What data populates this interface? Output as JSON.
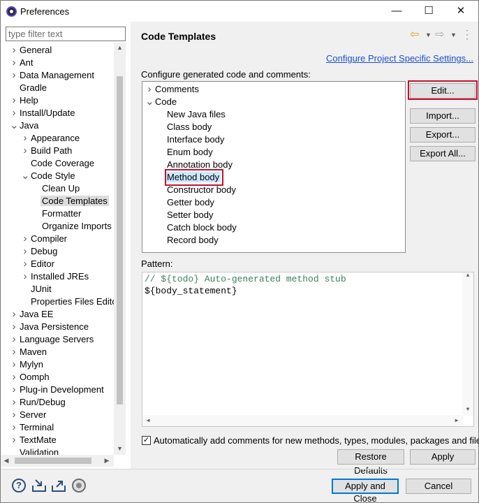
{
  "window": {
    "title": "Preferences",
    "minimize": "—",
    "maximize": "☐",
    "close": "✕"
  },
  "left": {
    "filter_placeholder": "type filter text",
    "items": [
      {
        "label": "General",
        "arrow": ">"
      },
      {
        "label": "Ant",
        "arrow": ">"
      },
      {
        "label": "Data Management",
        "arrow": ">"
      },
      {
        "label": "Gradle",
        "arrow": ""
      },
      {
        "label": "Help",
        "arrow": ">"
      },
      {
        "label": "Install/Update",
        "arrow": ">"
      },
      {
        "label": "Java",
        "arrow": "v"
      },
      {
        "label": "Appearance",
        "arrow": ">"
      },
      {
        "label": "Build Path",
        "arrow": ">"
      },
      {
        "label": "Code Coverage",
        "arrow": ""
      },
      {
        "label": "Code Style",
        "arrow": "v"
      },
      {
        "label": "Clean Up",
        "arrow": ""
      },
      {
        "label": "Code Templates",
        "arrow": ""
      },
      {
        "label": "Formatter",
        "arrow": ""
      },
      {
        "label": "Organize Imports",
        "arrow": ""
      },
      {
        "label": "Compiler",
        "arrow": ">"
      },
      {
        "label": "Debug",
        "arrow": ">"
      },
      {
        "label": "Editor",
        "arrow": ">"
      },
      {
        "label": "Installed JREs",
        "arrow": ">"
      },
      {
        "label": "JUnit",
        "arrow": ""
      },
      {
        "label": "Properties Files Editor",
        "arrow": ""
      },
      {
        "label": "Java EE",
        "arrow": ">"
      },
      {
        "label": "Java Persistence",
        "arrow": ">"
      },
      {
        "label": "Language Servers",
        "arrow": ">"
      },
      {
        "label": "Maven",
        "arrow": ">"
      },
      {
        "label": "Mylyn",
        "arrow": ">"
      },
      {
        "label": "Oomph",
        "arrow": ">"
      },
      {
        "label": "Plug-in Development",
        "arrow": ">"
      },
      {
        "label": "Run/Debug",
        "arrow": ">"
      },
      {
        "label": "Server",
        "arrow": ">"
      },
      {
        "label": "Terminal",
        "arrow": ">"
      },
      {
        "label": "TextMate",
        "arrow": ">"
      },
      {
        "label": "Validation",
        "arrow": ""
      }
    ]
  },
  "main": {
    "title": "Code Templates",
    "configure_link": "Configure Project Specific Settings...",
    "section_label": "Configure generated code and comments:",
    "templates": [
      {
        "label": "Comments",
        "arrow": ">"
      },
      {
        "label": "Code",
        "arrow": "v"
      },
      {
        "label": "New Java files",
        "arrow": ""
      },
      {
        "label": "Class body",
        "arrow": ""
      },
      {
        "label": "Interface body",
        "arrow": ""
      },
      {
        "label": "Enum body",
        "arrow": ""
      },
      {
        "label": "Annotation body",
        "arrow": ""
      },
      {
        "label": "Method body",
        "arrow": ""
      },
      {
        "label": "Constructor body",
        "arrow": ""
      },
      {
        "label": "Getter body",
        "arrow": ""
      },
      {
        "label": "Setter body",
        "arrow": ""
      },
      {
        "label": "Catch block body",
        "arrow": ""
      },
      {
        "label": "Record body",
        "arrow": ""
      }
    ],
    "buttons": {
      "edit": "Edit...",
      "import": "Import...",
      "export": "Export...",
      "export_all": "Export All..."
    },
    "pattern_label": "Pattern:",
    "pattern_lines": [
      "// ${todo} Auto-generated method stub",
      "${body_statement}"
    ],
    "auto_comments_label": "Automatically add comments for new methods, types, modules, packages and files",
    "auto_comments_checked": true,
    "restore_defaults": "Restore Defaults",
    "apply": "Apply"
  },
  "footer": {
    "apply_and_close": "Apply and Close",
    "cancel": "Cancel"
  },
  "colors": {
    "highlight_border": "#c8102e",
    "link": "#1a4fd0",
    "comment": "#3f7f5f",
    "selection": "#cce8ff"
  }
}
